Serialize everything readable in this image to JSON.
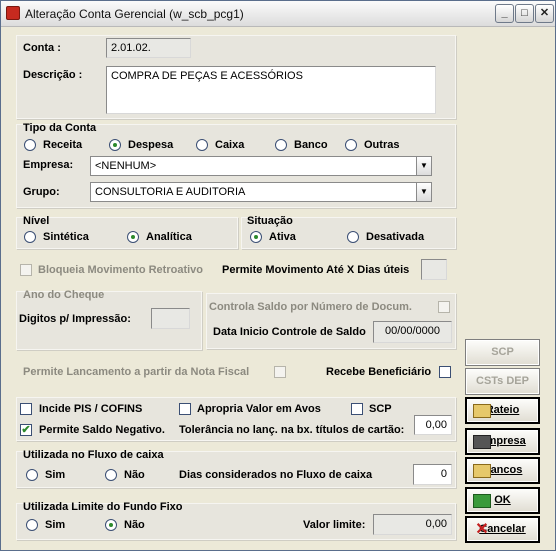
{
  "window": {
    "title": "Alteração Conta Gerencial (w_scb_pcg1)",
    "min": "_",
    "max": "□",
    "close": "✕"
  },
  "conta": {
    "label": "Conta :",
    "value": "2.01.02."
  },
  "descricao": {
    "label": "Descrição :",
    "value": "COMPRA DE PEÇAS E ACESSÓRIOS"
  },
  "tipo": {
    "label": "Tipo da Conta",
    "options": [
      "Receita",
      "Despesa",
      "Caixa",
      "Banco",
      "Outras"
    ],
    "selected": "Despesa"
  },
  "empresa": {
    "label": "Empresa:",
    "value": "<NENHUM>"
  },
  "grupo": {
    "label": "Grupo:",
    "value": "CONSULTORIA E AUDITORIA"
  },
  "nivel": {
    "label": "Nível",
    "options": [
      "Sintética",
      "Analítica"
    ],
    "selected": "Analítica"
  },
  "situacao": {
    "label": "Situação",
    "options": [
      "Ativa",
      "Desativada"
    ],
    "selected": "Ativa"
  },
  "bloqueia": {
    "label": "Bloqueia Movimento Retroativo"
  },
  "permite_mov": {
    "label": "Permite Movimento Até X Dias úteis",
    "value": ""
  },
  "cheque": {
    "label": "Ano do Cheque",
    "digitos_label": "Digitos p/ Impressão:",
    "digitos_value": ""
  },
  "controla": {
    "label": "Controla  Saldo por Número de Docum.",
    "data_label": "Data Inicio Controle de Saldo",
    "data_value": "00/00/0000"
  },
  "permite_nf": {
    "label": "Permite Lancamento a partir da Nota Fiscal"
  },
  "recebe": {
    "label": "Recebe Beneficiário"
  },
  "pis": {
    "label": "Incide PIS / COFINS",
    "checked": false
  },
  "apropria": {
    "label": "Apropria Valor em Avos",
    "checked": false
  },
  "scp": {
    "label": "SCP",
    "checked": false
  },
  "saldo_neg": {
    "label": "Permite Saldo Negativo.",
    "checked": true
  },
  "tolerancia": {
    "label": "Tolerância no lanç. na bx. títulos de cartão:",
    "value": "0,00"
  },
  "fluxo": {
    "label": "Utilizada no Fluxo de caixa",
    "options": [
      "Sim",
      "Não"
    ],
    "selected": "Não",
    "dias_label": "Dias considerados no Fluxo de caixa",
    "dias_value": "0"
  },
  "fundo": {
    "label": "Utilizada Limite do Fundo Fixo",
    "options": [
      "Sim",
      "Não"
    ],
    "selected": "Não",
    "valor_label": "Valor limite:",
    "valor_value": "0,00"
  },
  "buttons": {
    "scp": "SCP",
    "csts": "CSTs DEP",
    "rateio": "Rateio",
    "empresa": "Empresa",
    "bancos": "Bancos",
    "ok": "OK",
    "cancelar": "Cancelar"
  }
}
